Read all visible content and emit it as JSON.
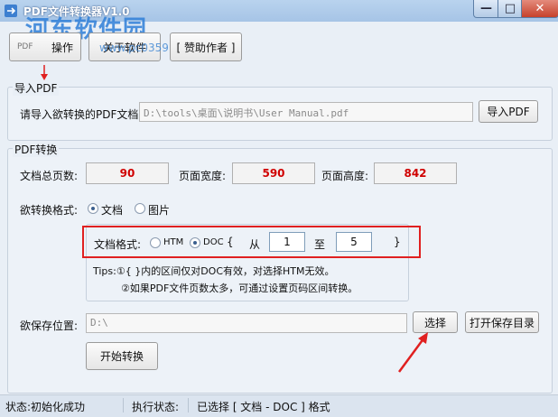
{
  "window": {
    "title": "PDF文件转换器V1.0",
    "watermark": "河东软件园",
    "watermark_url": "www.pc0359.cn",
    "controls": {
      "minimize": "—",
      "maximize": "□",
      "close": "✕"
    }
  },
  "toolbar": {
    "pdf_label": "PDF",
    "operate": "操作",
    "about": "关于软件",
    "sponsor": "[ 赞助作者 ]"
  },
  "import": {
    "group_title": "导入PDF",
    "prompt": "请导入欲转换的PDF文档:",
    "path": "D:\\tools\\桌面\\说明书\\User Manual.pdf",
    "button": "导入PDF"
  },
  "convert": {
    "group_title": "PDF转换",
    "total_pages_label": "文档总页数:",
    "total_pages": "90",
    "width_label": "页面宽度:",
    "width": "590",
    "height_label": "页面高度:",
    "height": "842",
    "format_label": "欲转换格式:",
    "format_options": [
      "文档",
      "图片"
    ],
    "doc_format_label": "文档格式:",
    "doc_options": [
      "HTM",
      "DOC"
    ],
    "range_open": "{",
    "from_label": "从",
    "from_value": "1",
    "to_label": "至",
    "to_value": "5",
    "range_close": "}",
    "tips_line1": "Tips:①{ }内的区间仅对DOC有效，对选择HTM无效。",
    "tips_line2": "②如果PDF文件页数太多，可通过设置页码区间转换。",
    "save_label": "欲保存位置:",
    "save_path": "D:\\",
    "select_button": "选择",
    "open_dir_button": "打开保存目录",
    "start_button": "开始转换"
  },
  "statusbar": {
    "status": "状态:初始化成功",
    "exec_label": "执行状态:",
    "exec_value": "已选择 [ 文档 - DOC ] 格式"
  },
  "colors": {
    "accent": "#e02020",
    "value": "#d00000"
  }
}
